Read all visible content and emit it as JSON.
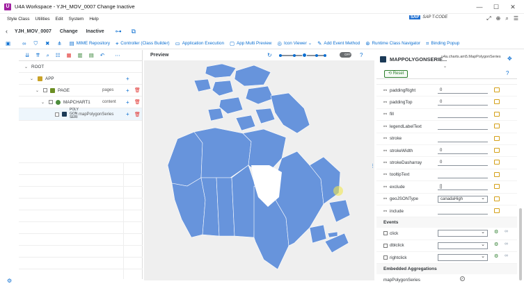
{
  "window": {
    "title": "U4A Workspace - YJH_MOV_0007 Change Inactive",
    "app_icon": "U"
  },
  "menu": {
    "items": [
      "Style Class",
      "Utilities",
      "Edit",
      "System",
      "Help"
    ],
    "sap_logo": "SAP",
    "tcode": "SAP T-CODE"
  },
  "header": {
    "object": "YJH_MOV_0007",
    "mode": "Change",
    "status": "Inactive"
  },
  "toolbar": {
    "mime": "MIME Repository",
    "controller": "Controller (Class Builder)",
    "app_exec": "Application Execution",
    "multi_preview": "App Multi Preview",
    "icon_viewer": "Icon Viewer",
    "add_event": "Add Event Method",
    "runtime_nav": "Runtime Class Navigator",
    "binding_popup": "Binding Popup"
  },
  "tree": {
    "root": "ROOT",
    "app": "APP",
    "page": "PAGE",
    "page_agg": "pages",
    "mapchart": "MAPCHART1",
    "mapchart_agg": "content",
    "series": "POLY GON SERI",
    "series_agg": "mapPolygonSeries"
  },
  "preview": {
    "title": "Preview",
    "toggle": "OFF"
  },
  "properties": {
    "name": "MAPPOLYGONSERIE...",
    "class_name": "u4a.charts.am5.MapPolygonSeries",
    "reset": "Reset",
    "rows": [
      {
        "label": "paddingRight",
        "value": "0",
        "type": "input"
      },
      {
        "label": "paddingTop",
        "value": "0",
        "type": "input"
      },
      {
        "label": "fill",
        "value": "",
        "type": "input"
      },
      {
        "label": "legendLabelText",
        "value": "",
        "type": "input"
      },
      {
        "label": "stroke",
        "value": "",
        "type": "input"
      },
      {
        "label": "strokeWidth",
        "value": "0",
        "type": "input"
      },
      {
        "label": "strokeDasharray",
        "value": "0",
        "type": "input"
      },
      {
        "label": "tooltipText",
        "value": "",
        "type": "input"
      },
      {
        "label": "exclude",
        "value": "[]",
        "type": "input"
      },
      {
        "label": "geoJSONType",
        "value": "canadaHigh",
        "type": "select"
      },
      {
        "label": "include",
        "value": "",
        "type": "input"
      }
    ],
    "events_title": "Events",
    "events": [
      {
        "label": "click"
      },
      {
        "label": "dblclick"
      },
      {
        "label": "rightclick"
      }
    ],
    "aggregations_title": "Embedded Aggregations",
    "aggregations": [
      {
        "label": "mapPolygonSeries"
      }
    ]
  },
  "colors": {
    "accent": "#0a6ed1",
    "map_fill": "#6794dc",
    "delete": "#e0322f"
  }
}
